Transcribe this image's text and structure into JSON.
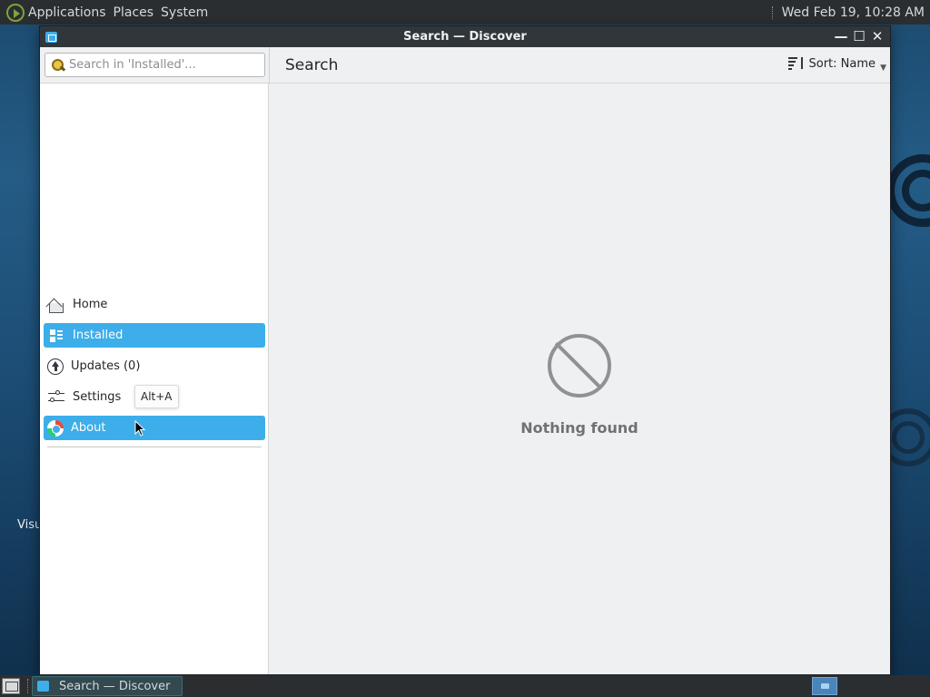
{
  "top_panel": {
    "menus": [
      "Applications",
      "Places",
      "System"
    ],
    "clock": "Wed Feb 19, 10:28 AM"
  },
  "desktop": {
    "partial_label": "Visu"
  },
  "window": {
    "title": "Search — Discover",
    "controls": [
      "minimize",
      "maximize",
      "close"
    ]
  },
  "toolbar": {
    "search_placeholder": "Search in 'Installed'...",
    "page_title": "Search",
    "sort_label": "Sort: Name"
  },
  "sidebar": {
    "items": [
      {
        "label": "Home",
        "icon": "home-icon",
        "active": false
      },
      {
        "label": "Installed",
        "icon": "installed-icon",
        "active": true
      },
      {
        "label": "Updates (0)",
        "icon": "updates-icon",
        "active": false
      },
      {
        "label": "Settings",
        "icon": "settings-icon",
        "active": false
      },
      {
        "label": "About",
        "icon": "about-icon",
        "active": true
      }
    ],
    "tooltip": "Alt+A"
  },
  "main": {
    "empty_message": "Nothing found"
  },
  "taskbar": {
    "task_label": "Search — Discover"
  },
  "colors": {
    "accent": "#3daee9",
    "panel": "#2b2e31",
    "titlebar": "#31363b"
  }
}
